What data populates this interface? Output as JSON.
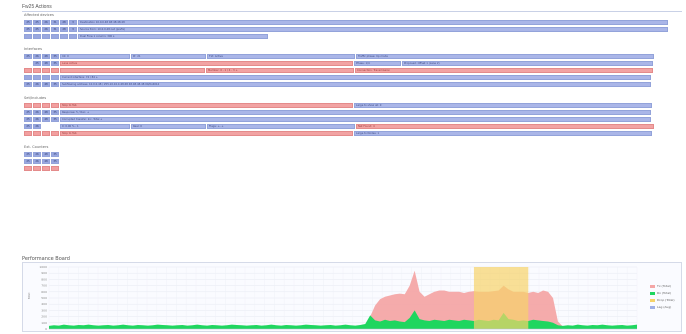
{
  "rows_section": {
    "title": "Fw25 Actions",
    "groups": [
      {
        "label": "Affected devices",
        "rows": [
          {
            "hdr": [
              {
                "t": "25",
                "c": "b"
              },
              {
                "t": "25",
                "c": "b"
              },
              {
                "t": "26",
                "c": "b"
              },
              {
                "t": "31",
                "c": "b"
              },
              {
                "t": "28",
                "c": "b"
              },
              {
                "t": "3",
                "c": "b"
              }
            ],
            "cells": [
              {
                "t": "Destination 10.0.0.48 48:48:48:48",
                "w": 590,
                "c": "b"
              }
            ]
          },
          {
            "hdr": [
              {
                "t": "25",
                "c": "b"
              },
              {
                "t": "25",
                "c": "b"
              },
              {
                "t": "26",
                "c": "b"
              },
              {
                "t": "31",
                "c": "b"
              },
              {
                "t": "28",
                "c": "b"
              },
              {
                "t": "3",
                "c": "b"
              }
            ],
            "cells": [
              {
                "t": "Source from: 10.0.0.48 net (prefix)",
                "w": 590,
                "c": "b"
              }
            ]
          },
          {
            "hdr": [
              {
                "t": "",
                "c": "b"
              },
              {
                "t": "",
                "c": "b"
              },
              {
                "t": "",
                "c": "b"
              },
              {
                "t": "",
                "c": "b"
              },
              {
                "t": "",
                "c": "b"
              },
              {
                "t": "",
                "c": "b"
              }
            ],
            "cells": [
              {
                "t": "Dual Flow 1 column: 300 s",
                "w": 190,
                "c": "b"
              }
            ]
          }
        ]
      },
      {
        "label": "Interfaces",
        "rows": [
          {
            "hdr": [
              {
                "t": "25",
                "c": "b"
              },
              {
                "t": "26",
                "c": "b"
              },
              {
                "t": "48",
                "c": "b"
              },
              {
                "t": "35",
                "c": "b"
              }
            ],
            "cells": [
              {
                "t": "Int: 0",
                "w": 70,
                "c": "b"
              },
              {
                "t": "Pr: 21",
                "w": 75,
                "c": "b"
              },
              {
                "t": "Txt: Active",
                "w": 148,
                "c": "b"
              },
              {
                "t": "Traffic phase: Up mode",
                "w": 298,
                "c": "b"
              }
            ]
          },
          {
            "hdr": [
              {
                "t": "",
                "c": "n"
              },
              {
                "t": "25",
                "c": "b"
              },
              {
                "t": "48",
                "c": "b"
              },
              {
                "t": "35",
                "c": "b"
              }
            ],
            "cells": [
              {
                "t": "Lane Active",
                "w": 293,
                "c": "r"
              },
              {
                "t": "Phase: 1/4",
                "w": 47,
                "c": "b"
              },
              {
                "t": "Proposed: Offset 1 (Lane 2)",
                "w": 251,
                "c": "b"
              }
            ]
          },
          {
            "hdr": [
              {
                "t": "",
                "c": "r"
              },
              {
                "t": "",
                "c": "r"
              },
              {
                "t": "",
                "c": "r"
              },
              {
                "t": "",
                "c": "r"
              }
            ],
            "cells": [
              {
                "t": "",
                "w": 145,
                "c": "r"
              },
              {
                "t": "Member: 0 - 1 / 4 - 3 +",
                "w": 148,
                "c": "r"
              },
              {
                "t": "Connection: Transmission",
                "w": 298,
                "c": "r"
              }
            ]
          },
          {
            "hdr": [
              {
                "t": "",
                "c": "b"
              },
              {
                "t": "",
                "c": "b"
              },
              {
                "t": "",
                "c": "b"
              },
              {
                "t": "",
                "c": "b"
              }
            ],
            "cells": [
              {
                "t": "Current interface: 74 / 84 +",
                "w": 591,
                "c": "b"
              }
            ]
          },
          {
            "hdr": [
              {
                "t": "25",
                "c": "b"
              },
              {
                "t": "26",
                "c": "b"
              },
              {
                "t": "48",
                "c": "b"
              },
              {
                "t": "35",
                "c": "b"
              }
            ],
            "cells": [
              {
                "t": "Subflowing address: 10.0.0.48 / 255.10.10.4:48:48 48.48.48.48 00/0x4014",
                "w": 591,
                "c": "b"
              }
            ]
          }
        ]
      },
      {
        "label": "Set/Includes",
        "rows": [
          {
            "hdr": [
              {
                "t": "",
                "c": "r"
              },
              {
                "t": "",
                "c": "r"
              },
              {
                "t": "",
                "c": "r"
              },
              {
                "t": "",
                "c": "r"
              }
            ],
            "cells": [
              {
                "t": "Stop to Tab",
                "w": 293,
                "c": "r"
              },
              {
                "t": "Large to show all: 0",
                "w": 298,
                "c": "b"
              }
            ]
          },
          {
            "hdr": [
              {
                "t": "25",
                "c": "b"
              },
              {
                "t": "26",
                "c": "b"
              },
              {
                "t": "48",
                "c": "b"
              },
              {
                "t": "35",
                "c": "b"
              }
            ],
            "cells": [
              {
                "t": "Response: 5 / Run: +",
                "w": 591,
                "c": "b"
              }
            ]
          },
          {
            "hdr": [
              {
                "t": "25",
                "c": "b"
              },
              {
                "t": "26",
                "c": "b"
              },
              {
                "t": "48",
                "c": "b"
              },
              {
                "t": "35",
                "c": "b"
              }
            ],
            "cells": [
              {
                "t": "Corrupted transfer: Inc. Total +",
                "w": 591,
                "c": "b"
              }
            ]
          },
          {
            "hdr": [
              {
                "t": "25",
                "c": "b"
              },
              {
                "t": "26",
                "c": "b"
              },
              {
                "t": "",
                "c": "n"
              },
              {
                "t": "",
                "c": "n"
              }
            ],
            "cells": [
              {
                "t": "0: 0.00 % - 1",
                "w": 70,
                "c": "b"
              },
              {
                "t": "Real: 0",
                "w": 75,
                "c": "b"
              },
              {
                "t": "Flags: +- +",
                "w": 148,
                "c": "b"
              },
              {
                "t": "Net Found: 4",
                "w": 298,
                "c": "r"
              }
            ]
          },
          {
            "hdr": [
              {
                "t": "",
                "c": "r"
              },
              {
                "t": "",
                "c": "r"
              },
              {
                "t": "",
                "c": "r"
              },
              {
                "t": "",
                "c": "r"
              }
            ],
            "cells": [
              {
                "t": "Stop to Tab",
                "w": 293,
                "c": "r"
              },
              {
                "t": "Large to Nodes: 1",
                "w": 298,
                "c": "b"
              }
            ]
          }
        ]
      },
      {
        "label": "Ext. Counters",
        "rows": [
          {
            "hdr": [
              {
                "t": "25",
                "c": "b"
              },
              {
                "t": "26",
                "c": "b"
              },
              {
                "t": "48",
                "c": "b"
              },
              {
                "t": "35",
                "c": "b"
              }
            ],
            "cells": []
          },
          {
            "hdr": [
              {
                "t": "25",
                "c": "b"
              },
              {
                "t": "26",
                "c": "b"
              },
              {
                "t": "48",
                "c": "b"
              },
              {
                "t": "35",
                "c": "b"
              }
            ],
            "cells": []
          },
          {
            "hdr": [
              {
                "t": "",
                "c": "r"
              },
              {
                "t": "",
                "c": "r"
              },
              {
                "t": "",
                "c": "r"
              },
              {
                "t": "",
                "c": "r"
              }
            ],
            "cells": []
          }
        ]
      }
    ]
  },
  "chart_section": {
    "title": "Performance Board",
    "ylabel": "Mbit",
    "legend": [
      {
        "label": "Tx (Total)",
        "color": "#f4a6a6"
      },
      {
        "label": "Rx (Total)",
        "color": "#1fd65f"
      },
      {
        "label": "Drop (Total)",
        "color": "#f6d36a"
      },
      {
        "label": "Lag (Avg)",
        "color": "#9fb0e6"
      }
    ]
  },
  "chart_data": {
    "type": "area",
    "title": "Performance Board",
    "ylabel": "Mbit",
    "yticks": [
      "1000",
      "900",
      "800",
      "700",
      "600",
      "500",
      "400",
      "300",
      "200",
      "100",
      "0"
    ],
    "ylim": [
      0,
      1000
    ],
    "x": [
      0,
      1,
      2,
      3,
      4,
      5,
      6,
      7,
      8,
      9,
      10,
      11,
      12,
      13,
      14,
      15,
      16,
      17,
      18,
      19,
      20,
      21,
      22,
      23,
      24,
      25,
      26,
      27,
      28,
      29,
      30,
      31,
      32,
      33,
      34,
      35,
      36,
      37,
      38,
      39,
      40,
      41,
      42,
      43,
      44,
      45,
      46,
      47,
      48,
      49,
      50,
      51,
      52,
      53,
      54,
      55,
      56,
      57,
      58,
      59,
      60,
      61,
      62,
      63,
      64,
      65,
      66,
      67,
      68,
      69,
      70,
      71,
      72,
      73,
      74,
      75,
      76,
      77,
      78,
      79,
      80,
      81,
      82,
      83,
      84,
      85,
      86,
      87,
      88,
      89,
      90,
      91,
      92,
      93,
      94,
      95,
      96,
      97,
      98,
      99,
      100,
      101,
      102,
      103,
      104,
      105,
      106,
      107,
      108,
      109,
      110,
      111,
      112,
      113,
      114,
      115,
      116,
      117,
      118,
      119
    ],
    "series": [
      {
        "name": "Tx (Total)",
        "color": "#f4a6a6",
        "values": [
          20,
          20,
          20,
          20,
          20,
          20,
          20,
          20,
          20,
          20,
          20,
          20,
          20,
          20,
          20,
          20,
          20,
          20,
          20,
          20,
          20,
          20,
          20,
          20,
          20,
          20,
          20,
          20,
          20,
          20,
          20,
          20,
          20,
          20,
          20,
          20,
          20,
          20,
          20,
          20,
          20,
          20,
          20,
          20,
          20,
          20,
          20,
          20,
          20,
          20,
          20,
          20,
          20,
          20,
          20,
          20,
          20,
          20,
          20,
          20,
          20,
          20,
          20,
          20,
          40,
          200,
          380,
          480,
          520,
          540,
          560,
          570,
          560,
          700,
          940,
          600,
          520,
          560,
          600,
          620,
          620,
          600,
          600,
          600,
          580,
          600,
          610,
          600,
          600,
          600,
          610,
          620,
          700,
          640,
          600,
          600,
          600,
          580,
          600,
          580,
          620,
          600,
          500,
          120,
          40,
          20,
          20,
          20,
          20,
          20,
          20,
          20,
          20,
          20,
          20,
          20,
          20,
          20,
          20,
          20
        ]
      },
      {
        "name": "Rx (Total)",
        "color": "#1fd65f",
        "values": [
          50,
          60,
          55,
          70,
          60,
          55,
          65,
          60,
          70,
          60,
          55,
          60,
          65,
          55,
          60,
          70,
          60,
          55,
          65,
          60,
          55,
          60,
          70,
          65,
          60,
          55,
          60,
          65,
          55,
          60,
          70,
          60,
          55,
          65,
          60,
          55,
          60,
          70,
          65,
          60,
          55,
          60,
          65,
          55,
          60,
          70,
          60,
          55,
          65,
          60,
          55,
          60,
          70,
          65,
          60,
          55,
          60,
          65,
          55,
          60,
          70,
          60,
          55,
          65,
          80,
          220,
          140,
          120,
          150,
          130,
          140,
          120,
          110,
          180,
          300,
          160,
          140,
          130,
          150,
          140,
          130,
          150,
          140,
          130,
          150,
          140,
          130,
          150,
          140,
          130,
          150,
          140,
          260,
          160,
          150,
          130,
          140,
          130,
          150,
          140,
          130,
          120,
          100,
          60,
          50,
          60,
          55,
          70,
          60,
          55,
          65,
          60,
          70,
          60,
          55,
          60,
          65,
          55,
          60,
          70
        ]
      },
      {
        "name": "Drop (Total)",
        "color": "#f6d36a",
        "range_x": [
          86,
          97
        ],
        "values": [
          1000
        ]
      }
    ],
    "grid": true,
    "legend_position": "right"
  }
}
